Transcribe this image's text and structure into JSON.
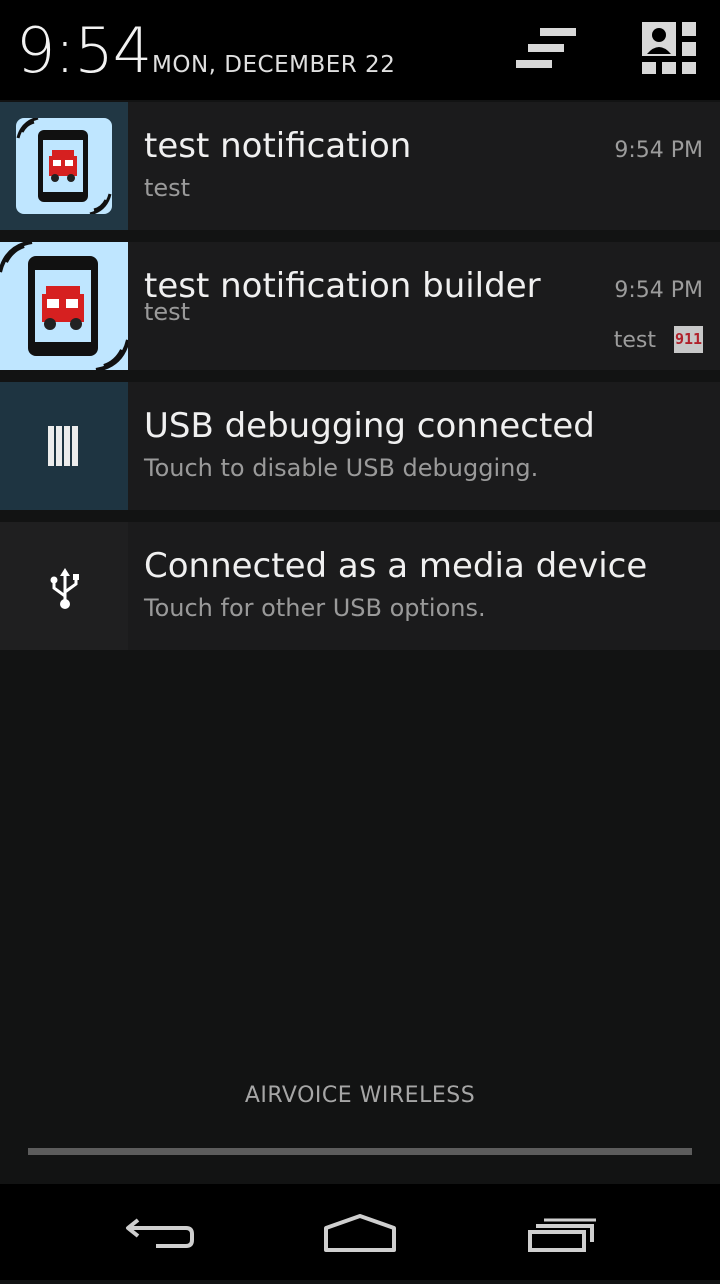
{
  "status": {
    "time": "9:54",
    "date": "MON, DECEMBER 22"
  },
  "header": {
    "settings_icon": "quick-settings-toggle-icon",
    "profile_icon": "user-grid-icon"
  },
  "notifications": [
    {
      "title": "test notification",
      "text": "test",
      "time": "9:54 PM",
      "icon": "fire-truck-phone-icon"
    },
    {
      "title": "test notification builder",
      "text": "test",
      "time": "9:54 PM",
      "info": "test",
      "small_icon_text": "911",
      "icon": "fire-truck-phone-icon"
    },
    {
      "title": "USB debugging connected",
      "text": "Touch to disable USB debugging.",
      "icon": "usb-debugging-icon"
    },
    {
      "title": "Connected as a media device",
      "text": "Touch for other USB options.",
      "icon": "usb-icon"
    }
  ],
  "carrier": "AIRVOICE WIRELESS",
  "nav": {
    "back": "back-icon",
    "home": "home-icon",
    "recents": "recents-icon"
  },
  "colors": {
    "icon_bg_app": "#bfe6ff",
    "icon_bg_system": "#1e3441"
  }
}
